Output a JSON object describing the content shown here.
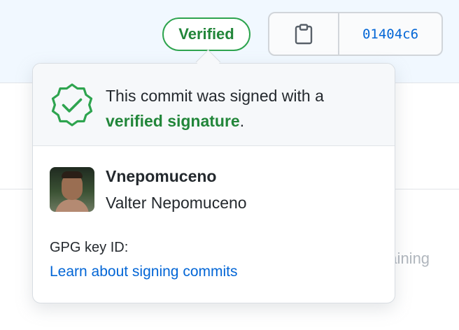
{
  "header": {
    "verified_badge": "Verified",
    "commit_sha": "01404c6"
  },
  "background": {
    "partial_text": "raining"
  },
  "popover": {
    "message_prefix": "This commit was signed with a",
    "message_link": "verified signature",
    "message_suffix": ".",
    "signer": {
      "username": "Vnepomuceno",
      "full_name": "Valter Nepomuceno"
    },
    "gpg_key_label": "GPG key ID:",
    "learn_link": "Learn about signing commits"
  },
  "icons": {
    "clipboard": "clipboard-icon",
    "verified": "verified-seal-icon"
  },
  "colors": {
    "verified_green": "#22863a",
    "link_blue": "#0366d6",
    "top_band": "#f1f8ff"
  }
}
